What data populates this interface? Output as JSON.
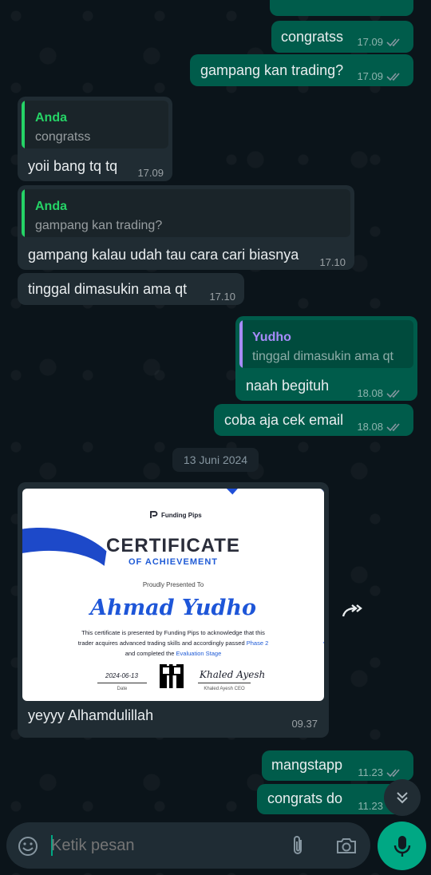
{
  "chat": {
    "messages": [
      {
        "text": "congratss",
        "time": "17.09"
      },
      {
        "text": "gampang kan trading?",
        "time": "17.09"
      },
      {
        "quote_name": "Anda",
        "quote_text": "congratss",
        "text": "yoii bang tq tq",
        "time": "17.09"
      },
      {
        "quote_name": "Anda",
        "quote_text": "gampang kan trading?",
        "text": "gampang kalau udah tau cara cari biasnya",
        "time": "17.10"
      },
      {
        "text": "tinggal dimasukin ama qt",
        "time": "17.10"
      },
      {
        "quote_name": "Yudho",
        "quote_text": "tinggal dimasukin ama qt",
        "text": "naah begituh",
        "time": "18.08"
      },
      {
        "text": "coba aja cek email",
        "time": "18.08"
      },
      {
        "text": "yeyyy Alhamdulillah",
        "time": "09.37"
      },
      {
        "text": "mangstapp",
        "time": "11.23"
      },
      {
        "text": "congrats do",
        "time": "11.23"
      }
    ],
    "date_separator": "13 Juni 2024"
  },
  "certificate": {
    "brand": "Funding Pips",
    "title": "CERTIFICATE",
    "subtitle": "OF ACHIEVEMENT",
    "presented": "Proudly Presented To",
    "name": "Ahmad Yudho",
    "body_1": "This certificate is presented by Funding Pips to acknowledge that this",
    "body_2": "trader acquires advanced trading skills and accordingly passed",
    "body_phase": "Phase 2",
    "body_3": "and completed the",
    "body_stage": "Evaluation Stage",
    "date": "2024-06-13",
    "date_label": "Date",
    "signature": "Khaled Ayesh",
    "signer_label": "Khaled Ayesh CEO"
  },
  "composer": {
    "placeholder": "Ketik pesan"
  },
  "colors": {
    "outgoing_bubble": "#005c4b",
    "incoming_bubble": "#202c33",
    "accent_green": "#00a884",
    "quote_anda": "#25d366",
    "quote_yudho": "#a78bfa",
    "read_tick": "#8696a0"
  },
  "icons": [
    "double-check-icon",
    "forward-icon",
    "chevrons-down-icon",
    "emoji-icon",
    "attach-icon",
    "camera-icon",
    "microphone-icon",
    "funding-pips-logo"
  ]
}
